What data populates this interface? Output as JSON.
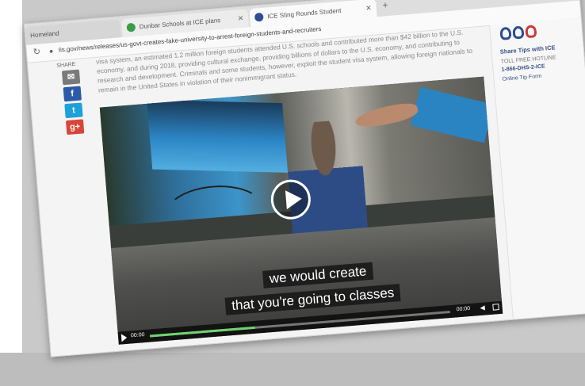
{
  "browser": {
    "tabs": [
      {
        "label": "Homeland",
        "active": false
      },
      {
        "label": "Dunbar Schools at ICE plans",
        "active": false
      },
      {
        "label": "ICE Sting Rounds Student",
        "active": true
      }
    ],
    "url": "Iis.gov/news/releases/us-govt-creates-fake-university-to-arrest-foreign-students-and-recruiters"
  },
  "share": {
    "label": "SHARE",
    "buttons": [
      "✉",
      "f",
      "t",
      "g+"
    ]
  },
  "article": {
    "text": "visa system, an estimated 1.2 million foreign students attended U.S. schools and contributed more than $42 billion to the U.S. economy, and during 2018, providing cultural exchange, providing billions of dollars to the U.S. economy, and contributing to research and development. Criminals and some students, however, exploit the student visa system, allowing foreign nationals to remain in the United States in violation of their nonimmigrant status."
  },
  "video": {
    "caption_line1": "we would create",
    "caption_line2": "that you're going to classes",
    "time_current": "00:00",
    "time_total": "00:00",
    "progress": 0.35
  },
  "sidebar": {
    "logo_letters": [
      "U",
      "U",
      "O"
    ],
    "tip_title": "Share Tips with ICE",
    "tollfree": "TOLL FREE HOTLINE",
    "phone": "1-866-DHS-2-ICE",
    "online": "Online Tip Form"
  },
  "colors": {
    "facebook": "#2d5aa8",
    "twitter": "#1da1d9",
    "google": "#d9453b",
    "progress": "#6fd36f",
    "link": "#3a4f86"
  }
}
